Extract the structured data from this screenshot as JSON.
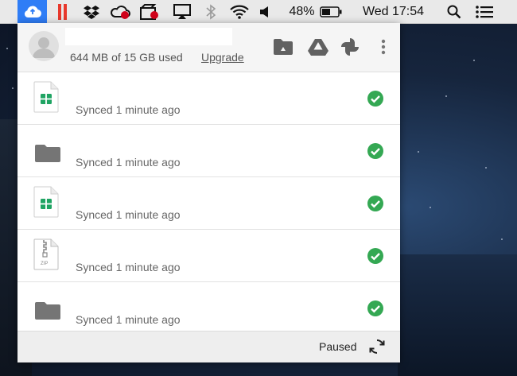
{
  "menubar": {
    "icons": [
      "drive-cloud-icon",
      "parallels-icon",
      "dropbox-icon",
      "creative-cloud-icon",
      "screen-recorder-icon",
      "airplay-icon",
      "bluetooth-icon",
      "wifi-icon",
      "volume-icon"
    ],
    "battery_percent": "48%",
    "clock": "Wed 17:54",
    "accent_color": "#2f7df6"
  },
  "header": {
    "account_name": "",
    "storage_text": "644 MB of 15 GB used",
    "upgrade_label": "Upgrade",
    "actions": [
      "open-folder-icon",
      "google-drive-icon",
      "google-photos-icon",
      "more-vert-icon"
    ]
  },
  "files": [
    {
      "icon": "sheets-file-icon",
      "name": "",
      "status": "Synced 1 minute ago",
      "synced": true
    },
    {
      "icon": "folder-icon",
      "name": "",
      "status": "Synced 1 minute ago",
      "synced": true
    },
    {
      "icon": "sheets-file-icon",
      "name": "",
      "status": "Synced 1 minute ago",
      "synced": true
    },
    {
      "icon": "zip-file-icon",
      "name": "",
      "status": "Synced 1 minute ago",
      "synced": true
    },
    {
      "icon": "folder-icon",
      "name": "",
      "status": "Synced 1 minute ago",
      "synced": true
    }
  ],
  "footer": {
    "status": "Paused",
    "sync_icon": "sync-icon"
  },
  "colors": {
    "synced_green": "#34a853",
    "sheets_green": "#1fa463"
  }
}
